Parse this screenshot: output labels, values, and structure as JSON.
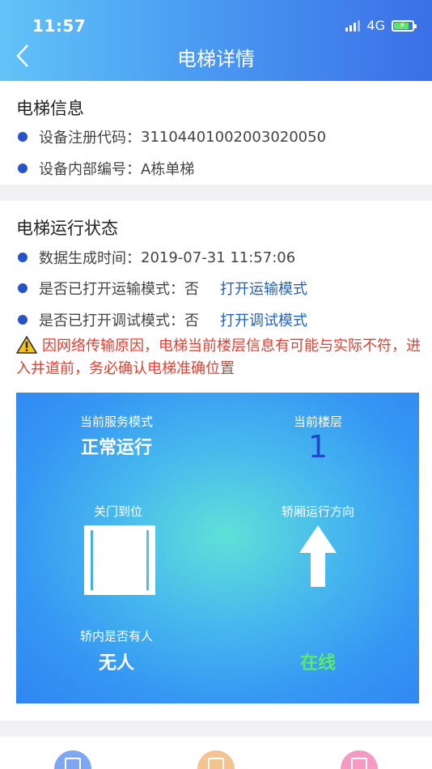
{
  "status_bar": {
    "time": "11:57",
    "network": "4G"
  },
  "nav": {
    "title": "电梯详情"
  },
  "elevator_info": {
    "title": "电梯信息",
    "rows": [
      {
        "label": "设备注册代码：",
        "value": "31104401002003020050"
      },
      {
        "label": "设备内部编号：",
        "value": "A栋单梯"
      }
    ]
  },
  "run_status": {
    "title": "电梯运行状态",
    "data_time": {
      "label": "数据生成时间：",
      "value": "2019-07-31 11:57:06"
    },
    "transport_mode": {
      "label": "是否已打开运输模式：",
      "value": "否",
      "action": "打开运输模式"
    },
    "debug_mode": {
      "label": "是否已打开调试模式：",
      "value": "否",
      "action": "打开调试模式"
    },
    "warning": "因网络传输原因，电梯当前楼层信息有可能与实际不符，进入井道前，务必确认电梯准确位置"
  },
  "panel": {
    "service_mode": {
      "label": "当前服务模式",
      "value": "正常运行"
    },
    "current_floor": {
      "label": "当前楼层",
      "value": "1"
    },
    "door": {
      "label": "关门到位"
    },
    "direction": {
      "label": "轿厢运行方向",
      "value": "up"
    },
    "occupancy": {
      "label": "轿内是否有人",
      "value": "无人"
    },
    "connection": {
      "value": "在线"
    }
  },
  "colors": {
    "header_start": "#62c3f7",
    "header_end": "#3b6fe8",
    "bullet": "#2853c7",
    "link": "#2060c8",
    "warning": "#e53d2f",
    "online": "#5bea6b",
    "floor": "#1e49c9"
  },
  "tabbar": {
    "items": [
      {
        "icon": "calendar-icon",
        "color": "#7fa6f2"
      },
      {
        "icon": "document-icon",
        "color": "#f5c38f"
      },
      {
        "icon": "document-icon",
        "color": "#f49ac3"
      }
    ]
  }
}
